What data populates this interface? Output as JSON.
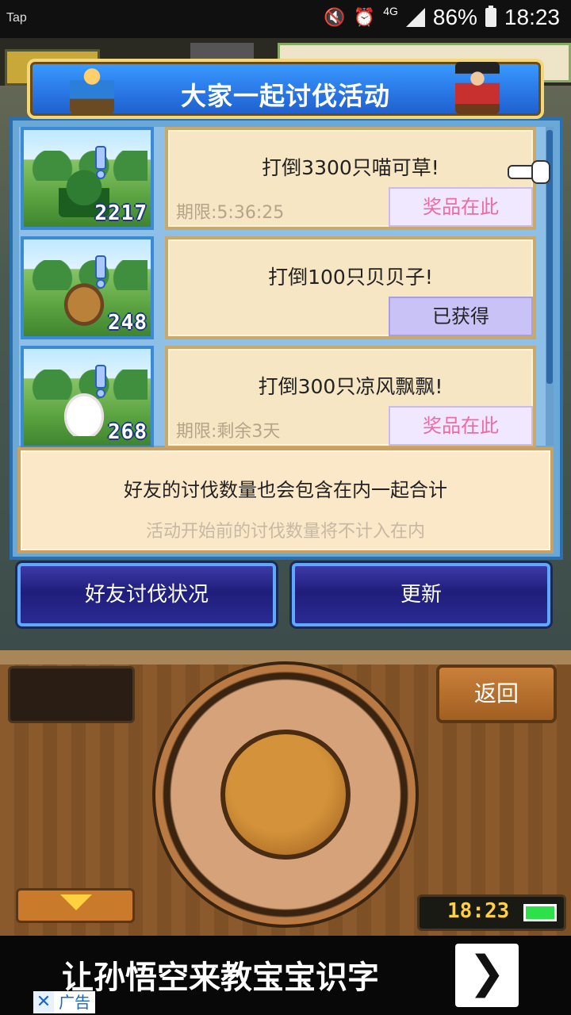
{
  "status_bar": {
    "app_label": "Tap",
    "network": "4G",
    "battery": "86%",
    "time": "18:23"
  },
  "panel": {
    "title": "大家一起讨伐活动"
  },
  "quests": [
    {
      "count": "2217",
      "title": "打倒3300只喵可草!",
      "limit": "期限:5:36:25",
      "button": "奖品在此",
      "status": "prize"
    },
    {
      "count": "248",
      "title": "打倒100只贝贝子!",
      "limit": "",
      "button": "已获得",
      "status": "obtained"
    },
    {
      "count": "268",
      "title": "打倒300只凉风飘飘!",
      "limit": "期限:剩余3天",
      "button": "奖品在此",
      "status": "prize"
    }
  ],
  "info": {
    "main": "好友的讨伐数量也会包含在内一起合计",
    "sub": "活动开始前的讨伐数量将不计入在内"
  },
  "buttons": {
    "friends": "好友讨伐状况",
    "refresh": "更新",
    "back": "返回"
  },
  "console": {
    "clock": "18:23"
  },
  "ad": {
    "text": "让孙悟空来教宝宝识字",
    "arrow": "❯",
    "close": "✕",
    "label": "广告"
  }
}
